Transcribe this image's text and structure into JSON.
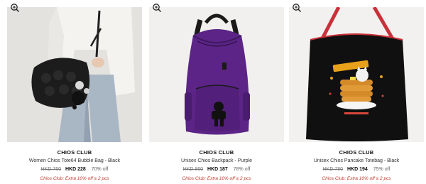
{
  "products": [
    {
      "brand": "CHIOS CLUB",
      "name": "Women Chios Tote64 Bubble Bag - Black",
      "old_price": "HKD 760",
      "new_price": "HKD 228",
      "discount": "70% off",
      "promo": "Chios Club: Extra 10% off ≥ 2 pcs"
    },
    {
      "brand": "CHIOS CLUB",
      "name": "Unisex Chios Backpack - Purple",
      "old_price": "HKD 860",
      "new_price": "HKD 187",
      "discount": "78% off",
      "promo": "Chios Club: Extra 10% off ≥ 2 pcs"
    },
    {
      "brand": "CHIOS CLUB",
      "name": "Unisex Chios Pancake Totebag - Black",
      "old_price": "HKD 780",
      "new_price": "HKD 194",
      "discount": "75% off",
      "promo": "Chios Club: Extra 10% off ≥ 2 pcs"
    }
  ],
  "icons": {
    "zoom": "zoom-in-icon"
  },
  "colors": {
    "promo": "#c0392b",
    "backpack": "#5b2486"
  }
}
